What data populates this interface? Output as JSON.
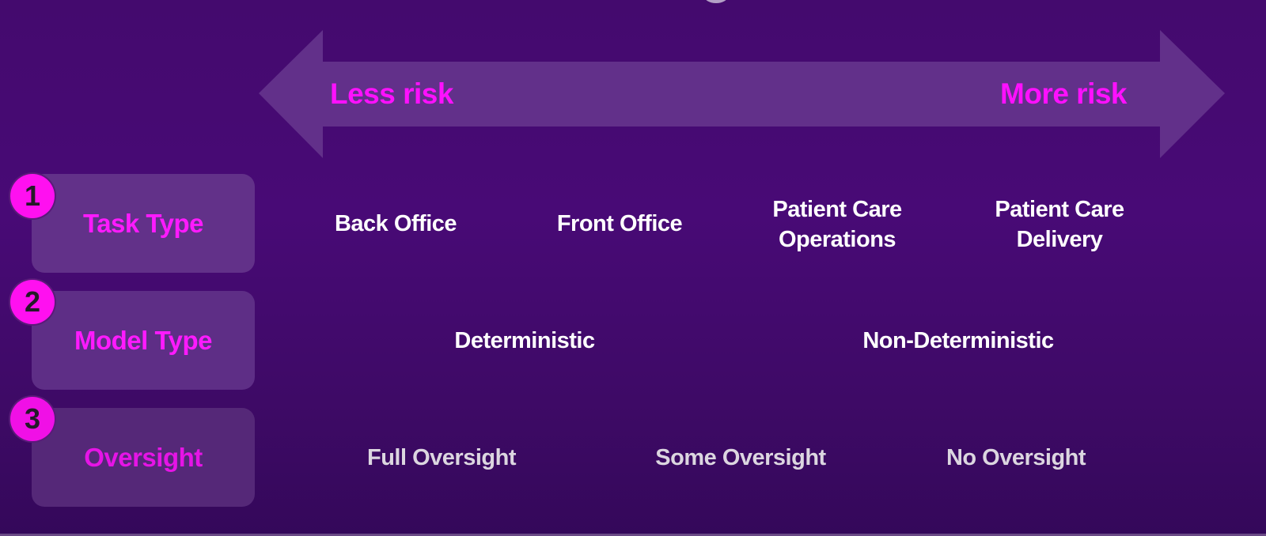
{
  "risk_scale": {
    "left_label": "Less risk",
    "right_label": "More risk"
  },
  "colors": {
    "accent": "#ff10ff",
    "box_fill": "#623189",
    "arrow_fill": "#62308a",
    "background": "#440a6e"
  },
  "rows": [
    {
      "number": "1",
      "label": "Task Type",
      "values": [
        "Back Office",
        "Front Office",
        "Patient Care\nOperations",
        "Patient Care\nDelivery"
      ]
    },
    {
      "number": "2",
      "label": "Model Type",
      "values": [
        "Deterministic",
        "Non-Deterministic"
      ]
    },
    {
      "number": "3",
      "label": "Oversight",
      "values": [
        "Full Oversight",
        "Some Oversight",
        "No Oversight"
      ]
    }
  ]
}
